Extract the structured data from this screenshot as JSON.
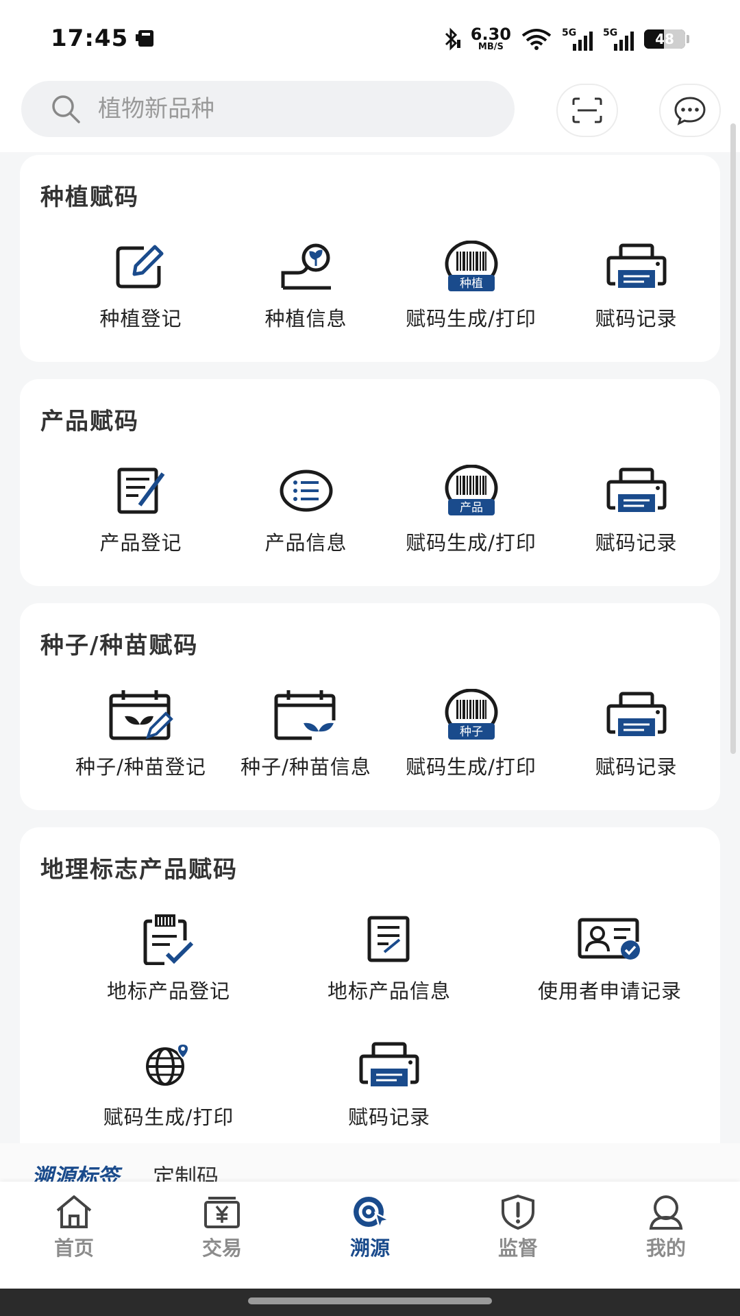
{
  "status_bar": {
    "time": "17:45",
    "speed_value": "6.30",
    "speed_unit": "MB/S",
    "network1": "5G",
    "network2": "5G",
    "battery": "48",
    "battery_level": 0.48
  },
  "search": {
    "placeholder": "植物新品种"
  },
  "sections": {
    "planting": {
      "title": "种植赋码",
      "items": [
        {
          "label": "种植登记",
          "icon": "edit-icon"
        },
        {
          "label": "种植信息",
          "icon": "seedling-info-icon"
        },
        {
          "label": "赋码生成/打印",
          "icon": "barcode-icon",
          "badge": "种植"
        },
        {
          "label": "赋码记录",
          "icon": "printer-icon"
        }
      ]
    },
    "product": {
      "title": "产品赋码",
      "items": [
        {
          "label": "产品登记",
          "icon": "document-edit-icon"
        },
        {
          "label": "产品信息",
          "icon": "list-icon"
        },
        {
          "label": "赋码生成/打印",
          "icon": "barcode-icon",
          "badge": "产品"
        },
        {
          "label": "赋码记录",
          "icon": "printer-icon"
        }
      ]
    },
    "seed": {
      "title": "种子/种苗赋码",
      "items": [
        {
          "label": "种子/种苗登记",
          "icon": "calendar-sprout-edit-icon"
        },
        {
          "label": "种子/种苗信息",
          "icon": "calendar-sprout-icon"
        },
        {
          "label": "赋码生成/打印",
          "icon": "barcode-icon",
          "badge": "种子"
        },
        {
          "label": "赋码记录",
          "icon": "printer-icon"
        }
      ]
    },
    "geo": {
      "title": "地理标志产品赋码",
      "items": [
        {
          "label": "地标产品登记",
          "icon": "clipboard-check-icon"
        },
        {
          "label": "地标产品信息",
          "icon": "document-icon"
        },
        {
          "label": "使用者申请记录",
          "icon": "id-card-check-icon"
        },
        {
          "label": "赋码生成/打印",
          "icon": "globe-pin-icon"
        },
        {
          "label": "赋码记录",
          "icon": "printer-icon"
        }
      ]
    }
  },
  "subtabs": {
    "active": "溯源标签",
    "other": "定制码"
  },
  "bottom_nav": [
    {
      "label": "首页",
      "icon": "home-icon"
    },
    {
      "label": "交易",
      "icon": "yuan-icon"
    },
    {
      "label": "溯源",
      "icon": "trace-icon",
      "active": true
    },
    {
      "label": "监督",
      "icon": "shield-alert-icon"
    },
    {
      "label": "我的",
      "icon": "user-icon"
    }
  ],
  "colors": {
    "accent": "#1a4b8c",
    "text": "#222222",
    "inactive": "#8c8c8c"
  }
}
